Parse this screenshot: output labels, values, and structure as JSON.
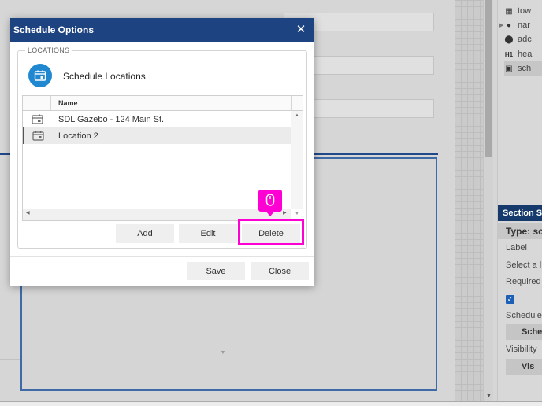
{
  "dialog": {
    "title": "Schedule Options",
    "close_icon": "close-icon",
    "section_legend": "LOCATIONS",
    "section_icon": "calendar-icon",
    "section_title": "Schedule Locations",
    "grid": {
      "column_header": "Name",
      "rows": [
        {
          "name": "SDL Gazebo - 124 Main St.",
          "icon": "calendar-icon",
          "selected": false
        },
        {
          "name": "Location 2",
          "icon": "calendar-icon",
          "selected": true
        }
      ]
    },
    "buttons": {
      "add": "Add",
      "edit": "Edit",
      "delete": "Delete"
    },
    "footer": {
      "save": "Save",
      "close": "Close"
    },
    "highlight_color": "#ff00d4",
    "cursor_icon": "mouse-icon"
  },
  "right_panel": {
    "tree_items": [
      {
        "icon": "calculator-icon",
        "label": "tow"
      },
      {
        "icon": "user-icon",
        "label": "nar"
      },
      {
        "icon": "map-pin-icon",
        "label": "adc"
      },
      {
        "icon": "heading-icon",
        "label": "hea"
      },
      {
        "icon": "calendar-icon",
        "label": "sch"
      }
    ],
    "section_header": "Section S",
    "type_label": "Type: sc",
    "labels": [
      "Label",
      "Select a l",
      "Required"
    ],
    "schedule_label": "Schedule",
    "schedule_button": "Schec",
    "visibility_label": "Visibility",
    "visibility_button": "Vis"
  },
  "colors": {
    "header_blue": "#1e4381",
    "accent_blue": "#1f88d0",
    "panel_header": "#163a6b"
  }
}
